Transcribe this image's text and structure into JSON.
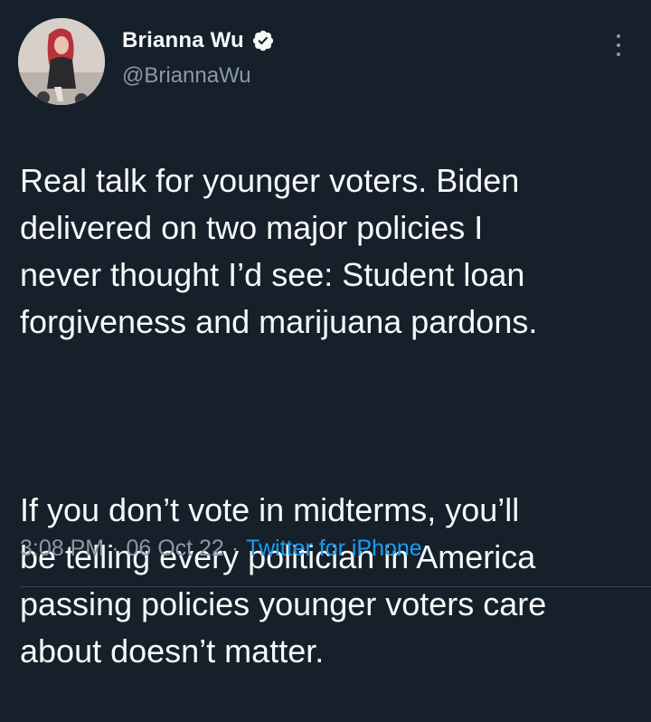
{
  "tweet": {
    "author": {
      "name": "Brianna Wu",
      "handle": "@BriannaWu",
      "verified": true,
      "avatar": "profile-photo"
    },
    "paragraph_1": "Real talk for younger voters. Biden\ndelivered on two major policies I\nnever thought I’d see: Student loan\nforgiveness and marijuana pardons.",
    "paragraph_2": "If you don’t vote in midterms, you’ll\nbe telling every politician in America\npassing policies younger voters care\nabout doesn’t matter.",
    "time": "3:08 PM",
    "separator": "·",
    "date": "06 Oct 22",
    "source": "Twitter for iPhone"
  },
  "icons": {
    "verified": "verified-badge-icon",
    "more": "more-options-icon"
  },
  "colors": {
    "background": "#15202b",
    "text": "#f7f9f9",
    "secondary": "#8b98a5",
    "link": "#1d9bf0"
  }
}
